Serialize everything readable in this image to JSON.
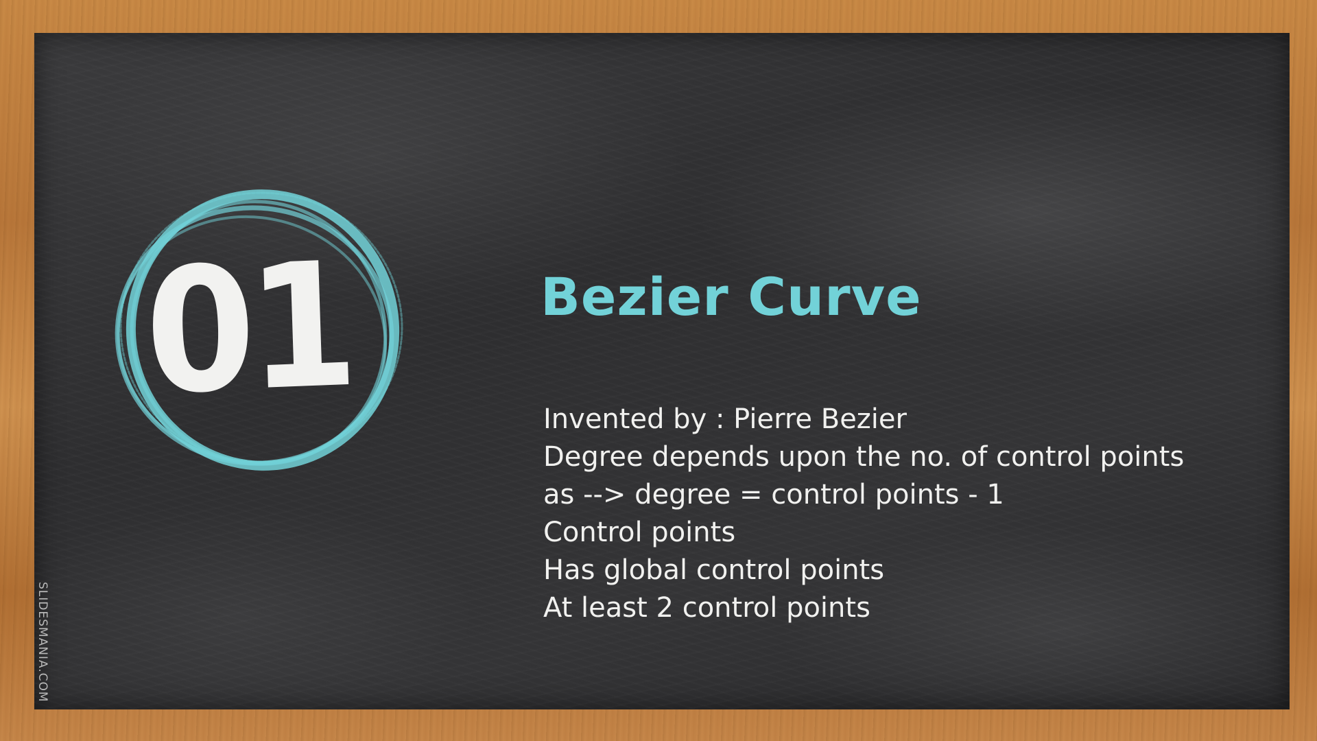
{
  "slide": {
    "number": "01",
    "title": "Bezier Curve",
    "bullets": [
      "Invented by : Pierre Bezier",
      "Degree depends upon the no. of control points",
      "as --> degree = control points - 1",
      "Control points",
      "Has global control points",
      "At least 2 control points"
    ],
    "watermark": "SLIDESMANIA.COM"
  },
  "colors": {
    "accent": "#72d2d8",
    "text": "#f1f1ef",
    "board": "#2f2f31",
    "frame": "#c0803f"
  }
}
